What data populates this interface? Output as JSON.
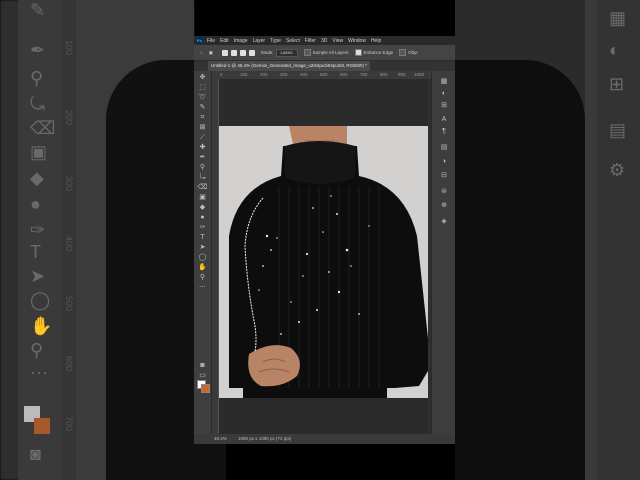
{
  "menubar": {
    "logo": "Ps",
    "items": [
      "File",
      "Edit",
      "Image",
      "Layer",
      "Type",
      "Select",
      "Filter",
      "3D",
      "View",
      "Window",
      "Help"
    ]
  },
  "optionsbar": {
    "mode_label": "Mode:",
    "mode_value": "Lasso",
    "sample_all_layers": "Sample All Layers",
    "enhance_edge": "Enhance Edge",
    "object_subtract": "Obje"
  },
  "document": {
    "tab_title": "Untitled-1 @ 48.4% (Gemini_Generated_Image_u2i84pu2i84pu2i8, RGB/8#) *"
  },
  "ruler_top": {
    "ticks": [
      "0",
      "100",
      "200",
      "300",
      "400",
      "500",
      "600",
      "700",
      "800",
      "900",
      "1000"
    ]
  },
  "statusbar": {
    "zoom": "48.4%",
    "doc_info": "1080 px x 1350 px (72 ppi)"
  },
  "background_ruler": {
    "numbers": [
      "100",
      "200",
      "300",
      "400",
      "500",
      "600",
      "700"
    ]
  },
  "colors": {
    "foreground": "#ffffff",
    "background": "#c96a2b",
    "canvas_backdrop": "#d2d1cf",
    "sweater": "#0d0d0d",
    "skin": "#b98466"
  }
}
